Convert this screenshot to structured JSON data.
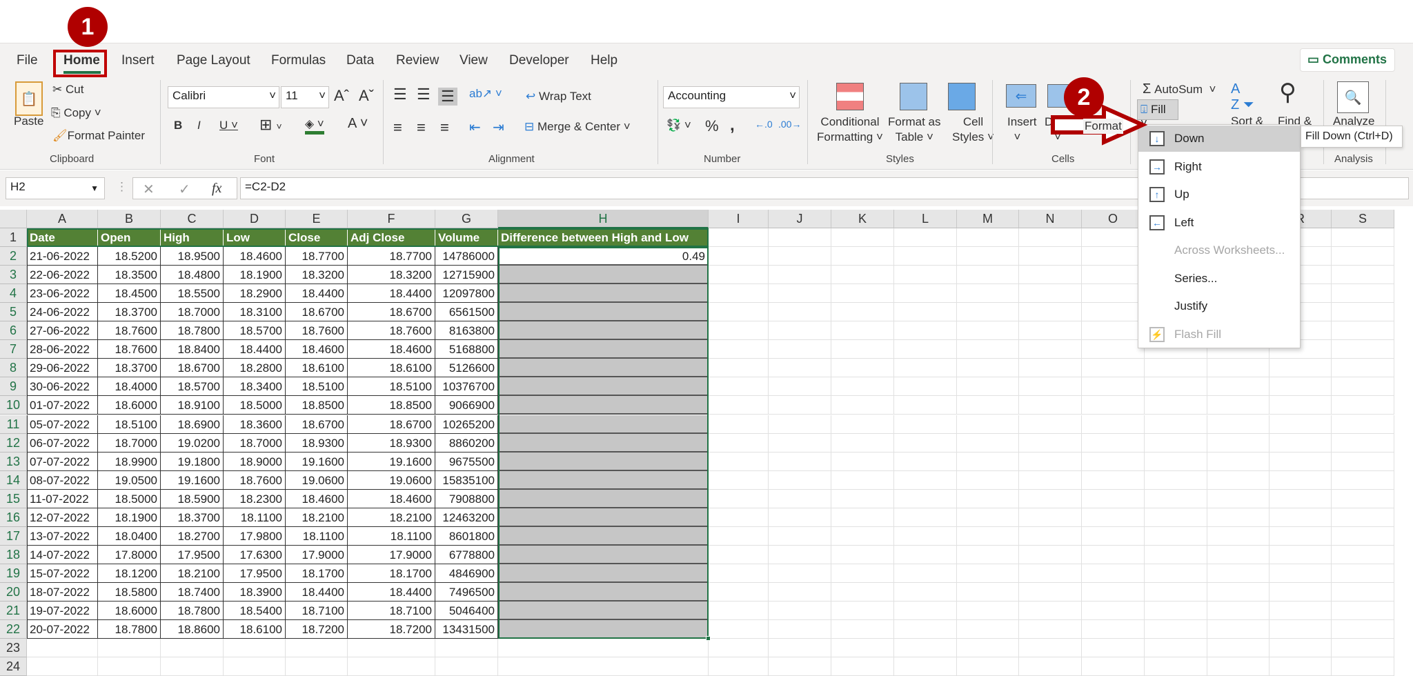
{
  "menu_tabs": [
    "File",
    "Home",
    "Insert",
    "Page Layout",
    "Formulas",
    "Data",
    "Review",
    "View",
    "Developer",
    "Help"
  ],
  "active_tab": "Home",
  "comments_label": "Comments",
  "clipboard": {
    "paste": "Paste",
    "cut": "Cut",
    "copy": "Copy",
    "format_painter": "Format Painter",
    "group": "Clipboard"
  },
  "font": {
    "name": "Calibri",
    "size": "11",
    "group": "Font"
  },
  "alignment": {
    "wrap_text": "Wrap Text",
    "merge_center": "Merge & Center",
    "group": "Alignment"
  },
  "number": {
    "format": "Accounting",
    "group": "Number"
  },
  "styles": {
    "conditional": [
      "Conditional",
      "Formatting"
    ],
    "format_as_table": [
      "Format as",
      "Table"
    ],
    "cell_styles": [
      "Cell",
      "Styles"
    ],
    "group": "Styles"
  },
  "cells": {
    "insert": "Insert",
    "delete": "Delete",
    "format": "Format",
    "group": "Cells"
  },
  "editing": {
    "autosum": "AutoSum",
    "fill": "Fill",
    "sort": "Sort &",
    "find": "Find &"
  },
  "analysis": {
    "analyze": "Analyze",
    "group": "Analysis"
  },
  "fill_menu": {
    "items": [
      {
        "label": "Down",
        "icon": "fill-down-icon",
        "enabled": true,
        "highlighted": true
      },
      {
        "label": "Right",
        "icon": "fill-right-icon",
        "enabled": true
      },
      {
        "label": "Up",
        "icon": "fill-up-icon",
        "enabled": true
      },
      {
        "label": "Left",
        "icon": "fill-left-icon",
        "enabled": true
      },
      {
        "label": "Across Worksheets...",
        "enabled": false
      },
      {
        "label": "Series...",
        "enabled": true
      },
      {
        "label": "Justify",
        "enabled": true
      },
      {
        "label": "Flash Fill",
        "icon": "flash-fill-icon",
        "enabled": false
      }
    ],
    "tooltip": "Fill Down (Ctrl+D)"
  },
  "annotations": {
    "step1": "1",
    "step2": "2",
    "color": "#c00000"
  },
  "formula_bar": {
    "name_box": "H2",
    "fx": "fx",
    "formula": "=C2-D2"
  },
  "sheet": {
    "columns": [
      "A",
      "B",
      "C",
      "D",
      "E",
      "F",
      "G",
      "H",
      "I",
      "J",
      "K",
      "L",
      "M",
      "N",
      "O",
      "P",
      "Q",
      "R",
      "S"
    ],
    "header_fill": "#538135",
    "headers": [
      "Date",
      "Open",
      "High",
      "Low",
      "Close",
      "Adj Close",
      "Volume",
      "Difference between High and Low"
    ],
    "rows": [
      [
        "21-06-2022",
        "18.5200",
        "18.9500",
        "18.4600",
        "18.7700",
        "18.7700",
        "14786000",
        "0.49"
      ],
      [
        "22-06-2022",
        "18.3500",
        "18.4800",
        "18.1900",
        "18.3200",
        "18.3200",
        "12715900",
        ""
      ],
      [
        "23-06-2022",
        "18.4500",
        "18.5500",
        "18.2900",
        "18.4400",
        "18.4400",
        "12097800",
        ""
      ],
      [
        "24-06-2022",
        "18.3700",
        "18.7000",
        "18.3100",
        "18.6700",
        "18.6700",
        "6561500",
        ""
      ],
      [
        "27-06-2022",
        "18.7600",
        "18.7800",
        "18.5700",
        "18.7600",
        "18.7600",
        "8163800",
        ""
      ],
      [
        "28-06-2022",
        "18.7600",
        "18.8400",
        "18.4400",
        "18.4600",
        "18.4600",
        "5168800",
        ""
      ],
      [
        "29-06-2022",
        "18.3700",
        "18.6700",
        "18.2800",
        "18.6100",
        "18.6100",
        "5126600",
        ""
      ],
      [
        "30-06-2022",
        "18.4000",
        "18.5700",
        "18.3400",
        "18.5100",
        "18.5100",
        "10376700",
        ""
      ],
      [
        "01-07-2022",
        "18.6000",
        "18.9100",
        "18.5000",
        "18.8500",
        "18.8500",
        "9066900",
        ""
      ],
      [
        "05-07-2022",
        "18.5100",
        "18.6900",
        "18.3600",
        "18.6700",
        "18.6700",
        "10265200",
        ""
      ],
      [
        "06-07-2022",
        "18.7000",
        "19.0200",
        "18.7000",
        "18.9300",
        "18.9300",
        "8860200",
        ""
      ],
      [
        "07-07-2022",
        "18.9900",
        "19.1800",
        "18.9000",
        "19.1600",
        "19.1600",
        "9675500",
        ""
      ],
      [
        "08-07-2022",
        "19.0500",
        "19.1600",
        "18.7600",
        "19.0600",
        "19.0600",
        "15835100",
        ""
      ],
      [
        "11-07-2022",
        "18.5000",
        "18.5900",
        "18.2300",
        "18.4600",
        "18.4600",
        "7908800",
        ""
      ],
      [
        "12-07-2022",
        "18.1900",
        "18.3700",
        "18.1100",
        "18.2100",
        "18.2100",
        "12463200",
        ""
      ],
      [
        "13-07-2022",
        "18.0400",
        "18.2700",
        "17.9800",
        "18.1100",
        "18.1100",
        "8601800",
        ""
      ],
      [
        "14-07-2022",
        "17.8000",
        "17.9500",
        "17.6300",
        "17.9000",
        "17.9000",
        "6778800",
        ""
      ],
      [
        "15-07-2022",
        "18.1200",
        "18.2100",
        "17.9500",
        "18.1700",
        "18.1700",
        "4846900",
        ""
      ],
      [
        "18-07-2022",
        "18.5800",
        "18.7400",
        "18.3900",
        "18.4400",
        "18.4400",
        "7496500",
        ""
      ],
      [
        "19-07-2022",
        "18.6000",
        "18.7800",
        "18.5400",
        "18.7100",
        "18.7100",
        "5046400",
        ""
      ],
      [
        "20-07-2022",
        "18.7800",
        "18.8600",
        "18.6100",
        "18.7200",
        "18.7200",
        "13431500",
        ""
      ]
    ],
    "extra_row_numbers": [
      "23",
      "24"
    ]
  }
}
